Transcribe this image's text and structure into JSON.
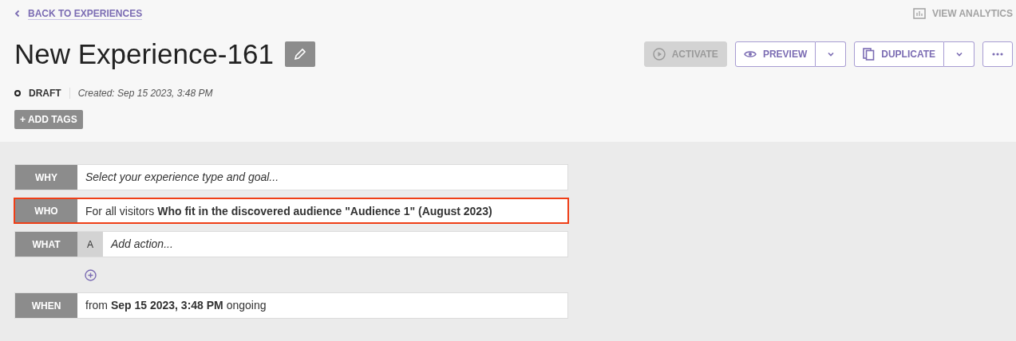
{
  "back_link": {
    "label": "BACK TO EXPERIENCES"
  },
  "view_analytics": {
    "label": "VIEW ANALYTICS",
    "disabled": true
  },
  "title": "New Experience-161",
  "actions": [
    {
      "kind": "activate",
      "label": "ACTIVATE",
      "disabled": true
    },
    {
      "kind": "preview",
      "label": "PREVIEW",
      "disabled": false
    },
    {
      "kind": "duplicate",
      "label": "DUPLICATE",
      "disabled": false
    },
    {
      "kind": "more",
      "disabled": false
    }
  ],
  "status": {
    "label": "DRAFT",
    "created": "Created: Sep 15 2023, 3:48 PM"
  },
  "add_tags": "+ ADD TAGS",
  "rows": [
    {
      "kind": "placeholder",
      "label": "WHY",
      "text": "Select your experience type and goal...",
      "highlighted": false
    },
    {
      "kind": "text",
      "label": "WHO",
      "text": "For all visitors **Who fit in the discovered audience \"Audience 1\" (August 2023)**",
      "highlighted": true
    },
    {
      "kind": "variant",
      "label": "WHAT",
      "variant": "A",
      "text": "Add action...",
      "highlighted": false
    },
    {
      "kind": "add"
    },
    {
      "kind": "text",
      "label": "WHEN",
      "text": "from **Sep 15 2023, 3:48 PM** ongoing",
      "highlighted": false
    }
  ]
}
